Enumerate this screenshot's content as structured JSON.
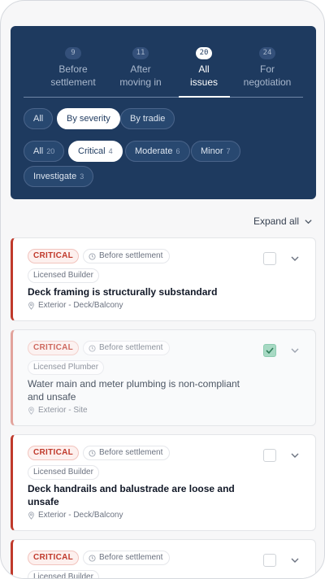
{
  "tabs": [
    {
      "count": "9",
      "label_l1": "Before",
      "label_l2": "settlement",
      "active": false
    },
    {
      "count": "11",
      "label_l1": "After",
      "label_l2": "moving in",
      "active": false
    },
    {
      "count": "20",
      "label_l1": "All",
      "label_l2": "issues",
      "active": true
    },
    {
      "count": "24",
      "label_l1": "For",
      "label_l2": "negotiation",
      "active": false
    }
  ],
  "view_filters": [
    {
      "label": "All",
      "selected": false
    },
    {
      "label": "By severity",
      "selected": true
    },
    {
      "label": "By tradie",
      "selected": false
    }
  ],
  "severity_filters": [
    {
      "label": "All",
      "count": "20",
      "selected": false
    },
    {
      "label": "Critical",
      "count": "4",
      "selected": true
    },
    {
      "label": "Moderate",
      "count": "6",
      "selected": false
    },
    {
      "label": "Minor",
      "count": "7",
      "selected": false
    },
    {
      "label": "Investigate",
      "count": "3",
      "selected": false
    }
  ],
  "expand_all_label": "Expand all",
  "issues": [
    {
      "severity": "CRITICAL",
      "phase": "Before settlement",
      "trade": "Licensed Builder",
      "title_l1": "Deck framing is structurally substandard",
      "title_l2": "",
      "location": "Exterior - Deck/Balcony",
      "checked": false
    },
    {
      "severity": "CRITICAL",
      "phase": "Before settlement",
      "trade": "Licensed Plumber",
      "title_l1": "Water main and meter plumbing is non-compliant",
      "title_l2": "and unsafe",
      "location": "Exterior - Site",
      "checked": true
    },
    {
      "severity": "CRITICAL",
      "phase": "Before settlement",
      "trade": "Licensed Builder",
      "title_l1": "Deck handrails and balustrade are loose and",
      "title_l2": "unsafe",
      "location": "Exterior - Deck/Balcony",
      "checked": false
    },
    {
      "severity": "CRITICAL",
      "phase": "Before settlement",
      "trade": "Licensed Builder",
      "title_l1": "",
      "title_l2": "",
      "location": "",
      "checked": false
    }
  ],
  "colors": {
    "panel": "#1e3a5f",
    "critical": "#c0392b",
    "checked": "#a7d9c3"
  }
}
